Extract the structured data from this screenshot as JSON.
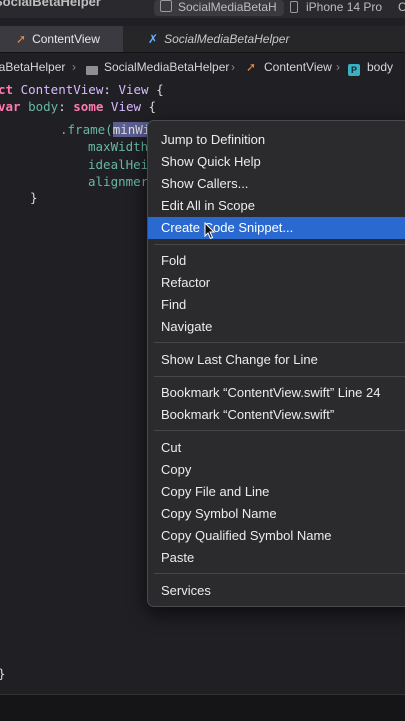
{
  "topbar": {
    "project": "SocialBetaHelper",
    "scheme_target": "SocialMediaBetaH",
    "device": "iPhone 14 Pro",
    "overflow": "C"
  },
  "tabs": [
    {
      "label": "ContentView",
      "icon": "swift-icon"
    },
    {
      "label": "SocialMediaBetaHelper",
      "icon": "app-icon"
    }
  ],
  "breadcrumb": {
    "items": [
      "iaBetaHelper",
      "SocialMediaBetaHelper",
      "ContentView",
      "body"
    ]
  },
  "code": {
    "line1": [
      "ct ",
      "ContentView",
      ": ",
      "View",
      " {"
    ],
    "line2": [
      "var ",
      "body",
      ": ",
      "some ",
      "View",
      " {"
    ],
    "line3": [
      ".frame(",
      "minWi"
    ],
    "line4": "maxWidth",
    "line5": "idealHei",
    "line6": "alignmer",
    "line7": "}",
    "line8": "}"
  },
  "context_menu": {
    "groups": [
      [
        "Jump to Definition",
        "Show Quick Help",
        "Show Callers...",
        "Edit All in Scope",
        "Create Code Snippet..."
      ],
      [
        "Fold",
        "Refactor",
        "Find",
        "Navigate"
      ],
      [
        "Show Last Change for Line"
      ],
      [
        "Bookmark “ContentView.swift” Line 24",
        "Bookmark “ContentView.swift”"
      ],
      [
        "Cut",
        "Copy",
        "Copy File and Line",
        "Copy Symbol Name",
        "Copy Qualified Symbol Name",
        "Paste"
      ],
      [
        "Services"
      ]
    ],
    "selected": "Create Code Snippet..."
  }
}
